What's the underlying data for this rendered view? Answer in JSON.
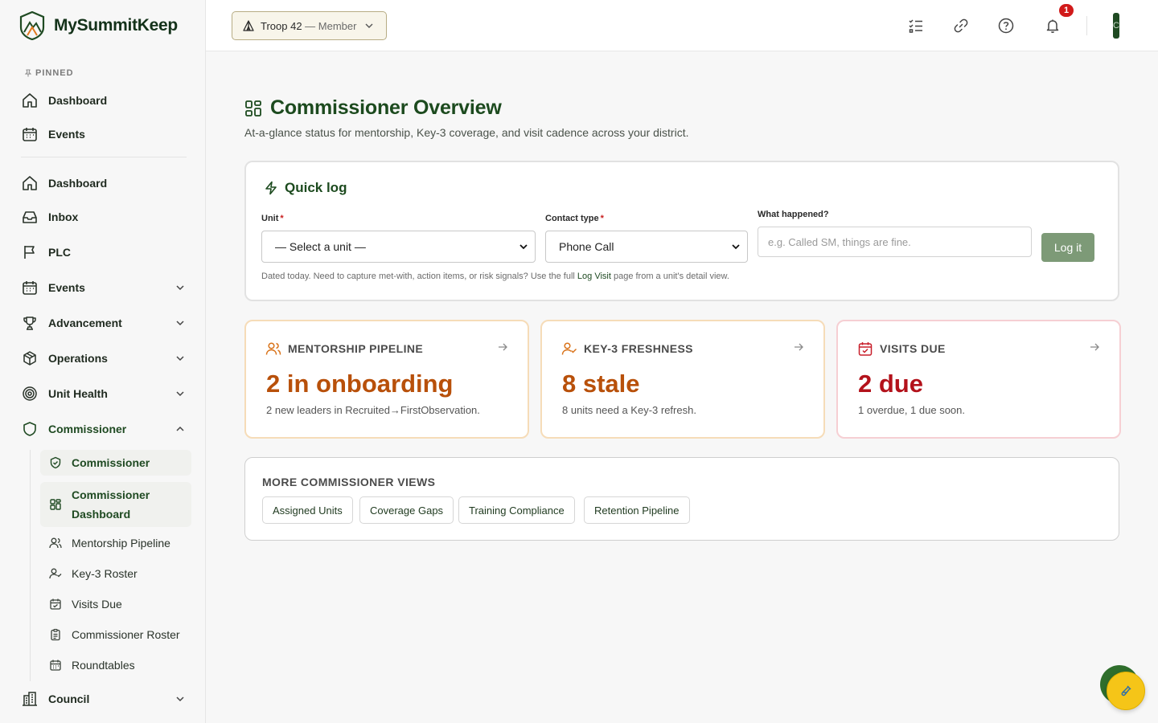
{
  "brand": {
    "name": "MySummitKeep"
  },
  "sidebar": {
    "pinned_label": "PINNED",
    "pinned": [
      {
        "label": "Dashboard",
        "icon": "home-icon"
      },
      {
        "label": "Events",
        "icon": "calendar-icon"
      }
    ],
    "items": [
      {
        "label": "Dashboard",
        "icon": "home-icon"
      },
      {
        "label": "Inbox",
        "icon": "inbox-icon"
      },
      {
        "label": "PLC",
        "icon": "flag-icon"
      },
      {
        "label": "Events",
        "icon": "calendar-icon",
        "expandable": true
      },
      {
        "label": "Advancement",
        "icon": "trophy-icon",
        "expandable": true
      },
      {
        "label": "Operations",
        "icon": "box-icon",
        "expandable": true
      },
      {
        "label": "Unit Health",
        "icon": "target-icon",
        "expandable": true
      },
      {
        "label": "Commissioner",
        "icon": "shield-icon",
        "expanded": true
      },
      {
        "label": "Council",
        "icon": "building-icon",
        "expandable": true
      }
    ],
    "commissioner_sub": [
      {
        "label": "Commissioner",
        "icon": "shield-check-icon",
        "active": true
      },
      {
        "label": "Commissioner Dashboard",
        "icon": "grid-icon",
        "active": true
      },
      {
        "label": "Mentorship Pipeline",
        "icon": "users-icon"
      },
      {
        "label": "Key-3 Roster",
        "icon": "user-check-icon"
      },
      {
        "label": "Visits Due",
        "icon": "calendar-check-icon"
      },
      {
        "label": "Commissioner Roster",
        "icon": "clipboard-icon"
      },
      {
        "label": "Roundtables",
        "icon": "calendar-icon"
      }
    ]
  },
  "topbar": {
    "unit_name": "Troop 42",
    "unit_role": " — Member",
    "notification_count": "1",
    "avatar_initial": "C"
  },
  "main": {
    "title": "Commissioner Overview",
    "subtitle": "At-a-glance status for mentorship, Key-3 coverage, and visit cadence across your district."
  },
  "quick_log": {
    "title": "Quick log",
    "unit_label": "Unit",
    "unit_value": "— Select a unit —",
    "contact_label": "Contact type",
    "contact_value": "Phone Call",
    "what_label": "What happened?",
    "what_placeholder": "e.g. Called SM, things are fine.",
    "button": "Log it",
    "hint_pre": "Dated today. Need to capture met-with, action items, or risk signals? Use the full ",
    "hint_link": "Log Visit",
    "hint_post": " page from a unit's detail view."
  },
  "stats": [
    {
      "title": "MENTORSHIP PIPELINE",
      "value": "2 in onboarding",
      "desc": "2 new leaders in Recruited→FirstObservation.",
      "color": "#b8500a"
    },
    {
      "title": "KEY-3 FRESHNESS",
      "value": "8 stale",
      "desc": "8 units need a Key-3 refresh.",
      "color": "#b8500a"
    },
    {
      "title": "VISITS DUE",
      "value": "2 due",
      "desc": "1 overdue, 1 due soon.",
      "color": "#b3121b"
    }
  ],
  "more": {
    "title": "MORE COMMISSIONER VIEWS",
    "links": [
      "Assigned Units",
      "Coverage Gaps",
      "Training Compliance",
      "Retention Pipeline"
    ]
  },
  "colors": {
    "brand_green": "#1c4a1e",
    "accent_orange": "#b8500a",
    "accent_red": "#b3121b"
  }
}
